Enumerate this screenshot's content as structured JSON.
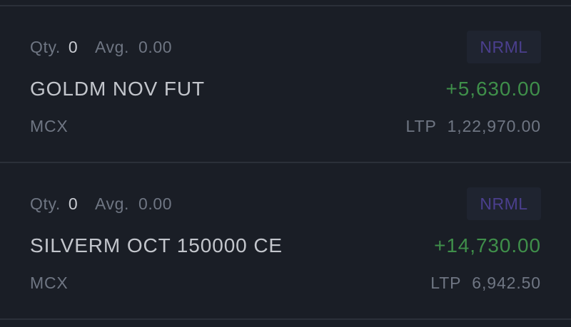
{
  "positions": [
    {
      "qty_label": "Qty.",
      "qty_value": "0",
      "avg_label": "Avg.",
      "avg_value": "0.00",
      "product": "NRML",
      "symbol": "GOLDM NOV FUT",
      "pnl": "+5,630.00",
      "exchange": "MCX",
      "ltp_label": "LTP",
      "ltp_value": "1,22,970.00"
    },
    {
      "qty_label": "Qty.",
      "qty_value": "0",
      "avg_label": "Avg.",
      "avg_value": "0.00",
      "product": "NRML",
      "symbol": "SILVERM OCT 150000 CE",
      "pnl": "+14,730.00",
      "exchange": "MCX",
      "ltp_label": "LTP",
      "ltp_value": "6,942.50"
    }
  ],
  "colors": {
    "background": "#1a1e26",
    "profit": "#3f8f4a",
    "badge_text": "#4b3f8e",
    "muted_text": "#6f7683",
    "primary_text": "#c3c6cc"
  }
}
